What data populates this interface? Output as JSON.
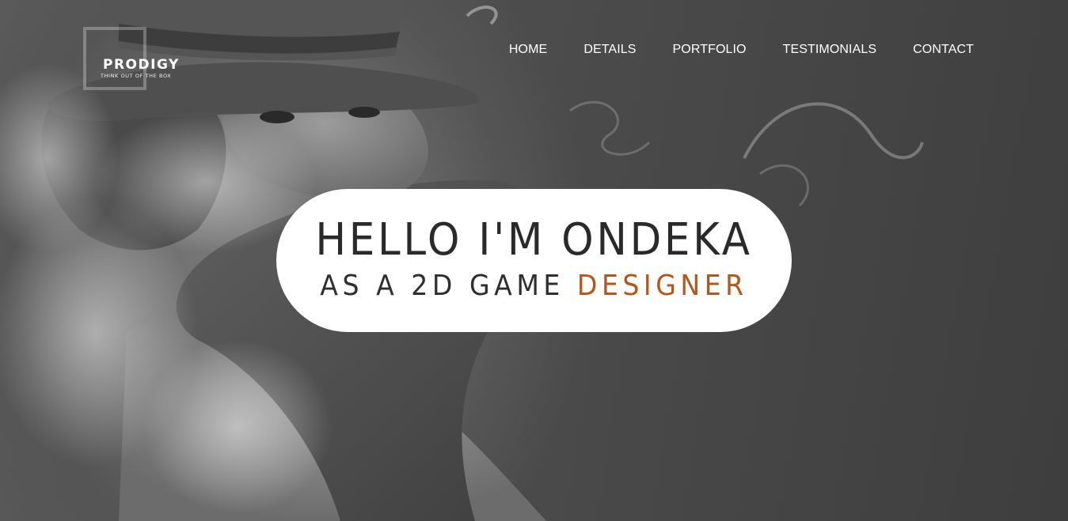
{
  "brand": {
    "name": "PRODIGY",
    "tagline": "THINK OUT OF THE BOX"
  },
  "nav": {
    "items": [
      "HOME",
      "DETAILS",
      "PORTFOLIO",
      "TESTIMONIALS",
      "CONTACT"
    ]
  },
  "hero": {
    "headline": "HELLO I'M ONDEKA",
    "subline_prefix": "AS A 2D GAME",
    "subline_highlight": "DESIGNER"
  },
  "colors": {
    "accent": "#b7561a",
    "text_dark": "#2a2a2a",
    "nav_text": "#ffffff",
    "card_bg": "#ffffff"
  }
}
